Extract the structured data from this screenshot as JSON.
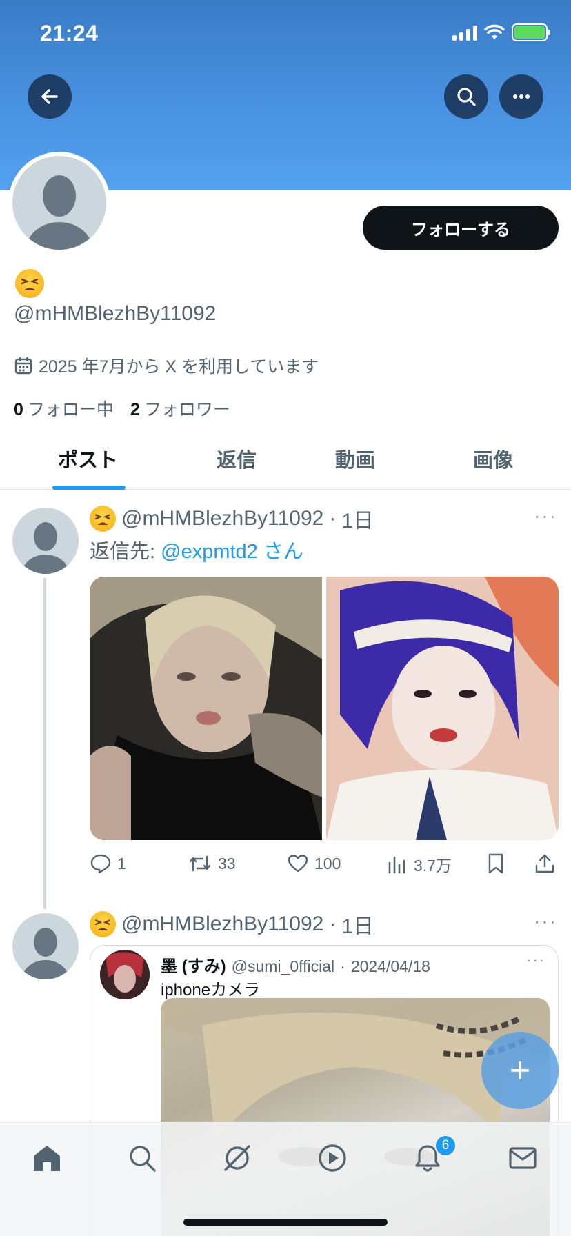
{
  "status_bar": {
    "time": "21:24"
  },
  "header": {
    "follow_label": "フォローする"
  },
  "profile": {
    "display_name_emoji": "tired-face-emoji",
    "handle": "@mHMBlezhBy11092",
    "joined": "2025 年7月から X を利用しています",
    "following_count": "0",
    "following_label": "フォロー中",
    "followers_count": "2",
    "followers_label": "フォロワー"
  },
  "tabs": [
    {
      "label": "ポスト",
      "active": true
    },
    {
      "label": "返信",
      "active": false
    },
    {
      "label": "動画",
      "active": false
    },
    {
      "label": "画像",
      "active": false
    }
  ],
  "posts": [
    {
      "handle": "@mHMBlezhBy11092",
      "separator": "·",
      "time": "1日",
      "reply_prefix": "返信先: ",
      "reply_mention": "@expmtd2 さん",
      "more": "···",
      "actions": {
        "replies": "1",
        "reposts": "33",
        "likes": "100",
        "views": "3.7万"
      }
    },
    {
      "handle": "@mHMBlezhBy11092",
      "separator": "·",
      "time": "1日",
      "more": "···",
      "quote": {
        "name": "墨 (すみ)",
        "handle": "@sumi_0fficial",
        "separator": "·",
        "date": "2024/04/18",
        "text": "iphoneカメラ",
        "more": "···"
      }
    }
  ],
  "fab": {
    "label": "+"
  },
  "bottom_nav": {
    "notification_count": "6"
  },
  "colors": {
    "accent": "#1d9bf0",
    "banner": "#4a93e2",
    "text_primary": "#0f1419",
    "text_secondary": "#536471"
  }
}
